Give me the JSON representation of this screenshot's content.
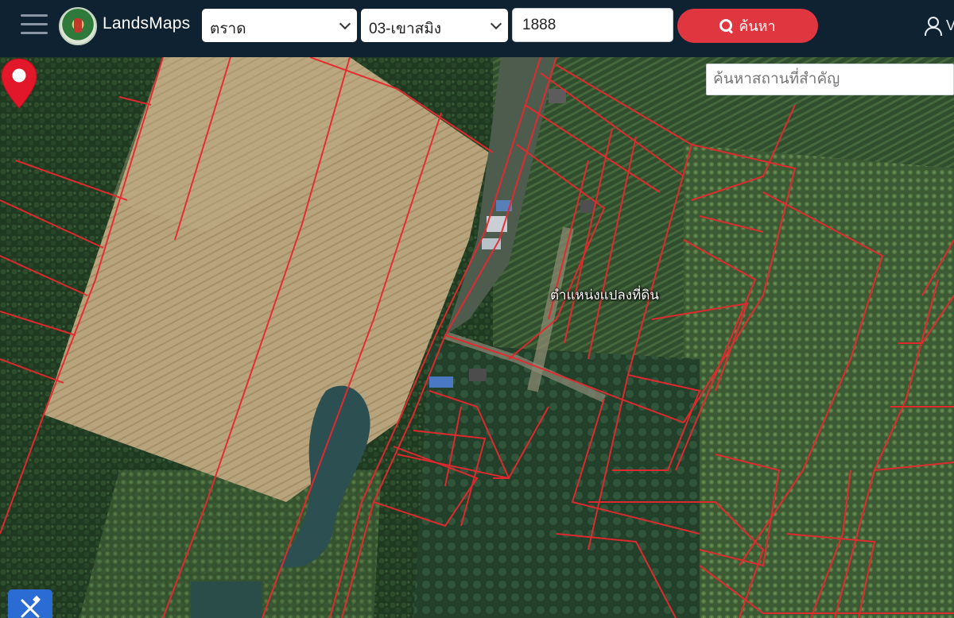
{
  "header": {
    "brand": "LandsMaps",
    "province": "ตราด",
    "district": "03-เขาสมิง",
    "parcel_number": "1888",
    "search_label": "ค้นหา",
    "user_initial": "V"
  },
  "map": {
    "poi_search_placeholder": "ค้นหาสถานที่สำคัญ",
    "pin_label": "ตำแหน่งแปลงที่ดิน"
  },
  "colors": {
    "header_bg": "#0f2232",
    "accent_red": "#e0363f",
    "parcel_line": "#e8282e",
    "tool_blue": "#2b6cd4"
  },
  "icons": {
    "menu": "hamburger-menu-icon",
    "search": "search-icon",
    "user": "user-icon",
    "pin": "map-pin-icon",
    "tool": "ruler-pencil-icon"
  }
}
